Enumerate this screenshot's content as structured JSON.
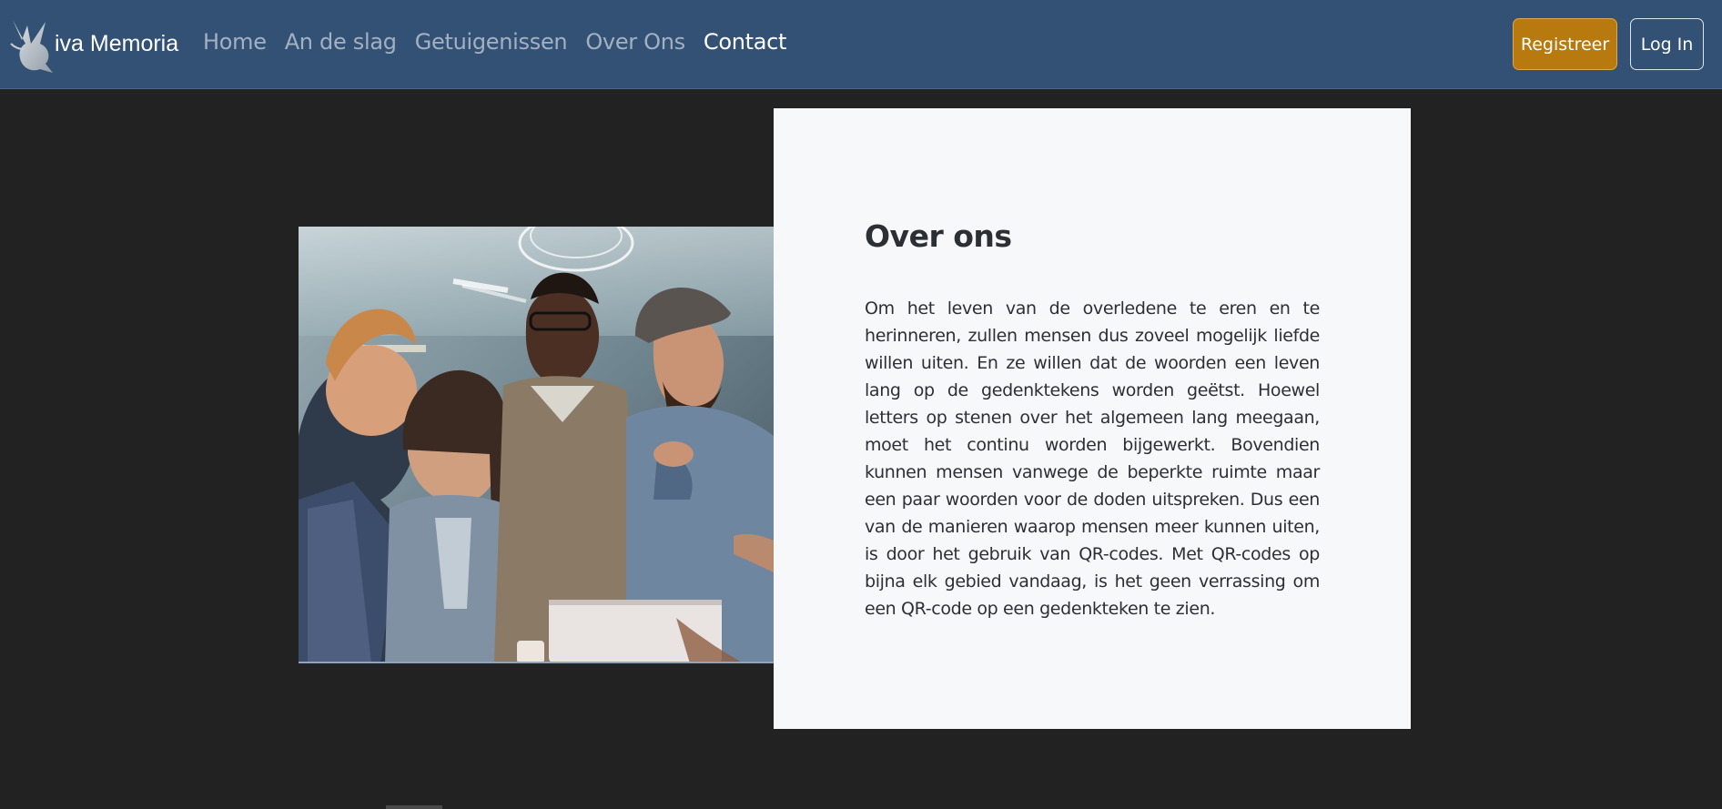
{
  "navbar": {
    "brand": {
      "logo_icon": "dove-icon",
      "text": "iva Memoria"
    },
    "links": [
      {
        "label": "Home",
        "active": false
      },
      {
        "label": "An de slag",
        "active": false
      },
      {
        "label": "Getuigenissen",
        "active": false
      },
      {
        "label": "Over Ons",
        "active": false
      },
      {
        "label": "Contact",
        "active": true
      }
    ],
    "register_label": "Registreer",
    "login_label": "Log In"
  },
  "about": {
    "image_subject": "group of four people looking at a laptop",
    "title": "Over ons",
    "text": "Om het leven van de overledene te eren en te herinneren, zullen mensen dus zoveel mogelijk liefde willen uiten. En ze willen dat de woorden een leven lang op de gedenktekens worden geëtst. Hoewel letters op stenen over het algemeen lang meegaan, moet het continu worden bijgewerkt. Bovendien kunnen mensen vanwege de beperkte ruimte maar een paar woorden voor de doden uitspreken. Dus een van de manieren waarop mensen meer kunnen uiten, is door het gebruik van QR-codes. Met QR-codes op bijna elk gebied vandaag, is het geen verrassing om een QR-code op een gedenkteken te zien."
  },
  "colors": {
    "navbar_bg": "#325174",
    "page_bg": "#222222",
    "card_bg": "#f7f8fa",
    "register_bg": "#b8790f"
  }
}
